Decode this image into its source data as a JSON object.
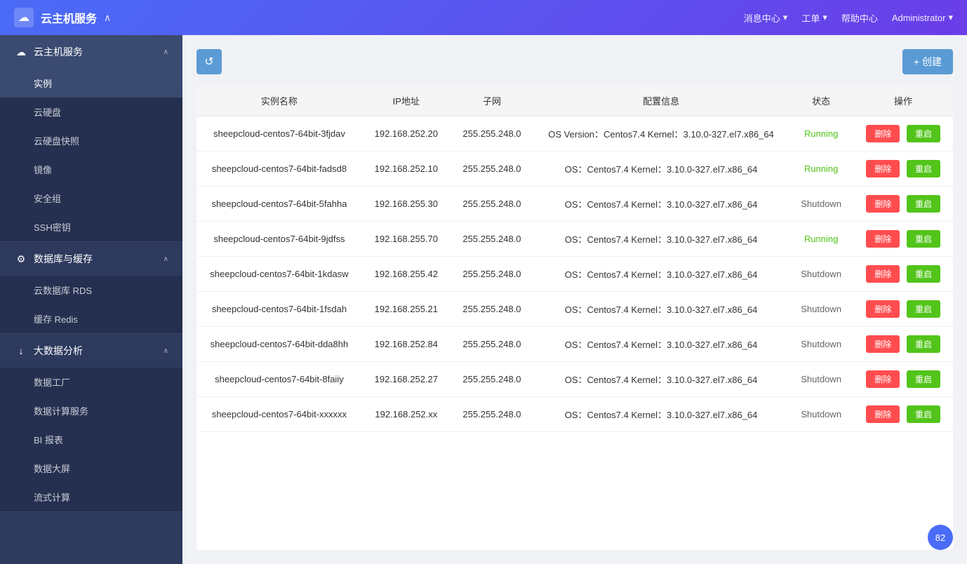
{
  "header": {
    "logo_icon": "☁",
    "title": "云主机服务",
    "collapse_icon": "∧",
    "nav": [
      {
        "label": "消息中心",
        "has_dropdown": true
      },
      {
        "label": "工单",
        "has_dropdown": true
      },
      {
        "label": "帮助中心",
        "has_dropdown": false
      },
      {
        "label": "Administrator",
        "has_dropdown": true
      }
    ]
  },
  "sidebar": {
    "sections": [
      {
        "id": "vm-service",
        "title": "云主机服务",
        "icon": "☁",
        "expanded": true,
        "items": [
          {
            "id": "instances",
            "label": "实例",
            "active": true
          },
          {
            "id": "volumes",
            "label": "云硬盘"
          },
          {
            "id": "snapshots",
            "label": "云硬盘快照"
          },
          {
            "id": "images",
            "label": "镜像"
          },
          {
            "id": "security-groups",
            "label": "安全组"
          },
          {
            "id": "ssh-keys",
            "label": "SSH密钥"
          }
        ]
      },
      {
        "id": "db-cache",
        "title": "数据库与缓存",
        "icon": "⚙",
        "expanded": true,
        "items": [
          {
            "id": "rds",
            "label": "云数据库 RDS"
          },
          {
            "id": "redis",
            "label": "缓存 Redis"
          }
        ]
      },
      {
        "id": "bigdata",
        "title": "大数据分析",
        "icon": "↓",
        "expanded": true,
        "items": [
          {
            "id": "data-factory",
            "label": "数据工厂"
          },
          {
            "id": "data-compute",
            "label": "数据计算服务"
          },
          {
            "id": "bi-report",
            "label": "BI 报表"
          },
          {
            "id": "data-screen",
            "label": "数据大屏"
          },
          {
            "id": "stream-compute",
            "label": "流式计算"
          }
        ]
      }
    ]
  },
  "toolbar": {
    "refresh_title": "刷新",
    "create_label": "+ 创建"
  },
  "table": {
    "columns": [
      "实例名称",
      "IP地址",
      "子网",
      "配置信息",
      "状态",
      "操作"
    ],
    "delete_label": "删除",
    "restart_label": "重启",
    "rows": [
      {
        "name": "sheepcloud-centos7-64bit-3fjdav",
        "ip": "192.168.252.20",
        "subnet": "255.255.248.0",
        "config": "OS Version：Centos7.4 Kernel：3.10.0-327.el7.x86_64",
        "status": "Running",
        "status_type": "running"
      },
      {
        "name": "sheepcloud-centos7-64bit-fadsd8",
        "ip": "192.168.252.10",
        "subnet": "255.255.248.0",
        "config": "OS：Centos7.4 Kernel：3.10.0-327.el7.x86_64",
        "status": "Running",
        "status_type": "running"
      },
      {
        "name": "sheepcloud-centos7-64bit-5fahha",
        "ip": "192.168.255.30",
        "subnet": "255.255.248.0",
        "config": "OS：Centos7.4 Kernel：3.10.0-327.el7.x86_64",
        "status": "Shutdown",
        "status_type": "shutdown"
      },
      {
        "name": "sheepcloud-centos7-64bit-9jdfss",
        "ip": "192.168.255.70",
        "subnet": "255.255.248.0",
        "config": "OS：Centos7.4 Kernel：3.10.0-327.el7.x86_64",
        "status": "Running",
        "status_type": "running"
      },
      {
        "name": "sheepcloud-centos7-64bit-1kdasw",
        "ip": "192.168.255.42",
        "subnet": "255.255.248.0",
        "config": "OS：Centos7.4 Kernel：3.10.0-327.el7.x86_64",
        "status": "Shutdown",
        "status_type": "shutdown"
      },
      {
        "name": "sheepcloud-centos7-64bit-1fsdah",
        "ip": "192.168.255.21",
        "subnet": "255.255.248.0",
        "config": "OS：Centos7.4 Kernel：3.10.0-327.el7.x86_64",
        "status": "Shutdown",
        "status_type": "shutdown"
      },
      {
        "name": "sheepcloud-centos7-64bit-dda8hh",
        "ip": "192.168.252.84",
        "subnet": "255.255.248.0",
        "config": "OS：Centos7.4 Kernel：3.10.0-327.el7.x86_64",
        "status": "Shutdown",
        "status_type": "shutdown"
      },
      {
        "name": "sheepcloud-centos7-64bit-8faiiy",
        "ip": "192.168.252.27",
        "subnet": "255.255.248.0",
        "config": "OS：Centos7.4 Kernel：3.10.0-327.el7.x86_64",
        "status": "Shutdown",
        "status_type": "shutdown"
      },
      {
        "name": "sheepcloud-centos7-64bit-xxxxxx",
        "ip": "192.168.252.xx",
        "subnet": "255.255.248.0",
        "config": "OS：Centos7.4 Kernel：3.10.0-327.el7.x86_64",
        "status": "Shutdown",
        "status_type": "shutdown"
      }
    ]
  },
  "avatar": {
    "label": "82"
  }
}
